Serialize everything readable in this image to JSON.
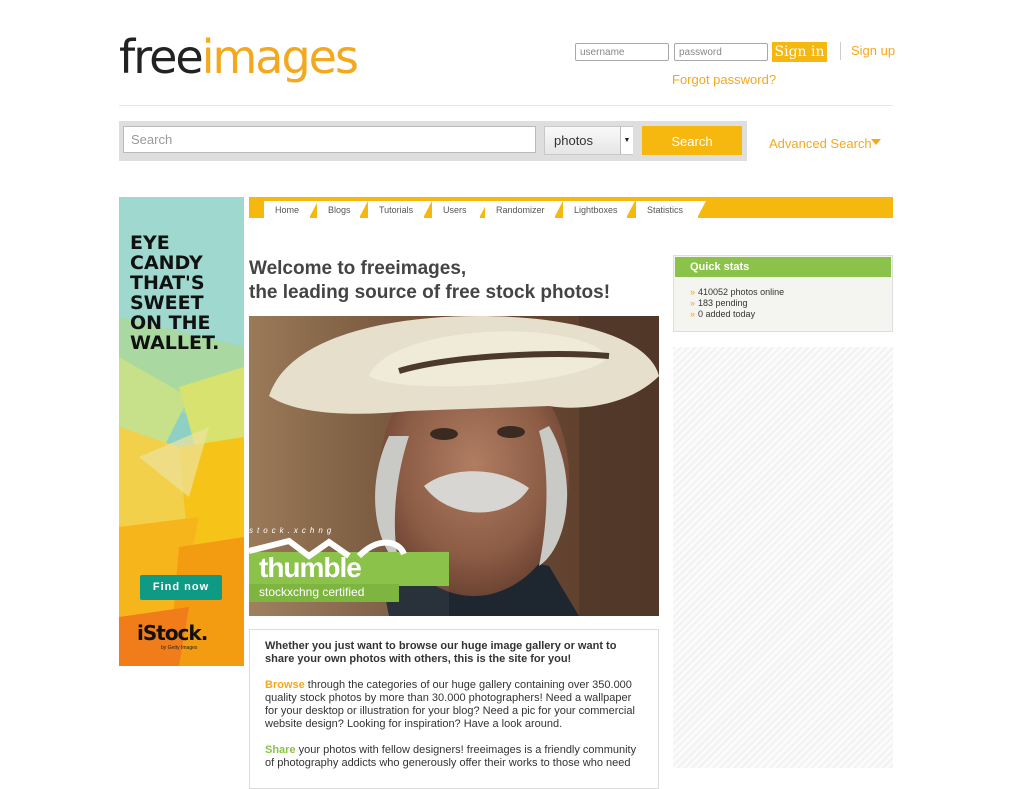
{
  "header": {
    "logo_free": "free",
    "logo_images": "images",
    "username_placeholder": "username",
    "password_placeholder": "password",
    "signin_label": "Sign in",
    "signup_label": "Sign up",
    "forgot_label": "Forgot password?"
  },
  "search": {
    "placeholder": "Search",
    "category_selected": "photos",
    "button_label": "Search",
    "advanced_label": "Advanced Search"
  },
  "ad": {
    "headline_lines": [
      "EYE",
      "CANDY",
      "THAT'S",
      "SWEET",
      "ON THE",
      "WALLET."
    ],
    "button_label": "Find now",
    "brand": "iStock.",
    "brand_sub": "by Getty Images"
  },
  "nav": {
    "tabs": [
      "Home",
      "Blogs",
      "Tutorials",
      "Users",
      "Randomizer",
      "Lightboxes",
      "Statistics"
    ]
  },
  "main": {
    "welcome_line1": "Welcome to freeimages,",
    "welcome_line2": "the leading source of free stock photos!",
    "photo_badge_small": "stock.xchng",
    "photo_badge_name": "thumble",
    "photo_badge_sub": "stockxchng certified",
    "intro_lead": "Whether you just want to browse our huge image gallery or want to share your own photos with others, this is the site for you!",
    "browse_keyword": "Browse",
    "browse_text": " through the categories of our huge gallery containing over 350.000 quality stock photos by more than 30.000 photographers! Need a wallpaper for your desktop or illustration for your blog? Need a pic for your commercial website design? Looking for inspiration? Have a look around.",
    "share_keyword": "Share",
    "share_text": " your photos with fellow designers! freeimages is a friendly community of photography addicts who generously offer their works to those who need"
  },
  "quick_stats": {
    "title": "Quick stats",
    "items": [
      "410052 photos online",
      "183 pending",
      "0 added today"
    ]
  },
  "colors": {
    "brand_orange": "#f4a81d",
    "button_yellow": "#f6b80f",
    "stats_green": "#8bc34a",
    "ad_teal": "#0f9a86"
  }
}
